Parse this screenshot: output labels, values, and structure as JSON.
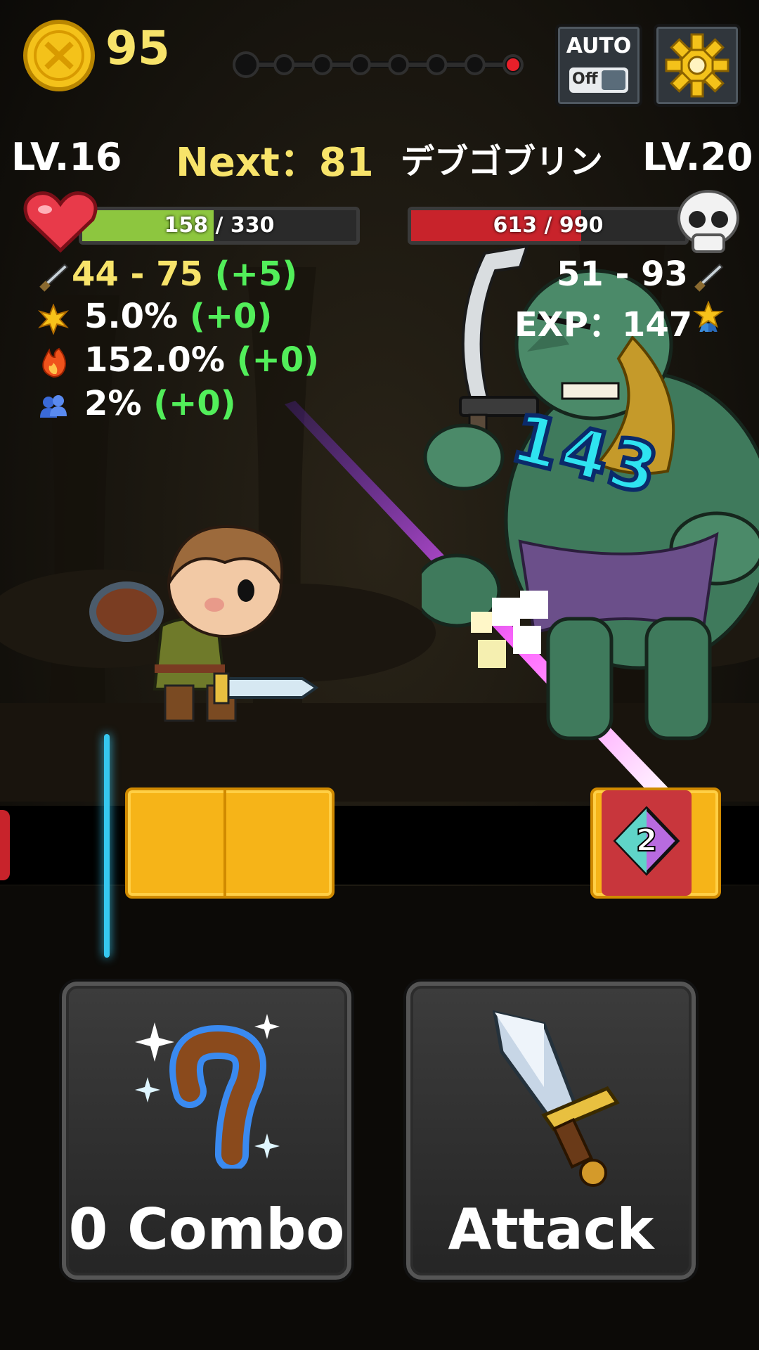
{
  "hud": {
    "coins": "95",
    "auto": {
      "label": "AUTO",
      "state": "Off"
    },
    "stage_progress": {
      "total": 8,
      "current": 8
    }
  },
  "player": {
    "level": "LV.16",
    "next_label": "Next：81",
    "hp_text": "158 / 330",
    "hp_fraction": 0.48,
    "stats": {
      "attack": "44 - 75",
      "attack_bonus": "(+5)",
      "critical": "5.0%",
      "critical_bonus": "(+0)",
      "crit_damage": "152.0%",
      "crit_damage_bonus": "(+0)",
      "party": "2%",
      "party_bonus": "(+0)"
    }
  },
  "enemy": {
    "name": "デブゴブリン",
    "level": "LV.20",
    "hp_text": "613 / 990",
    "hp_fraction": 0.62,
    "attack": "51 - 93",
    "exp": "EXP：147"
  },
  "battle": {
    "damage": "143",
    "skill_badge": "2"
  },
  "buttons": {
    "combo": "0 Combo",
    "attack": "Attack"
  },
  "colors": {
    "player_hp": "#8dc63f",
    "enemy_hp": "#c8232b",
    "bonus": "#52ee5a",
    "highlight": "#f7e36a"
  }
}
